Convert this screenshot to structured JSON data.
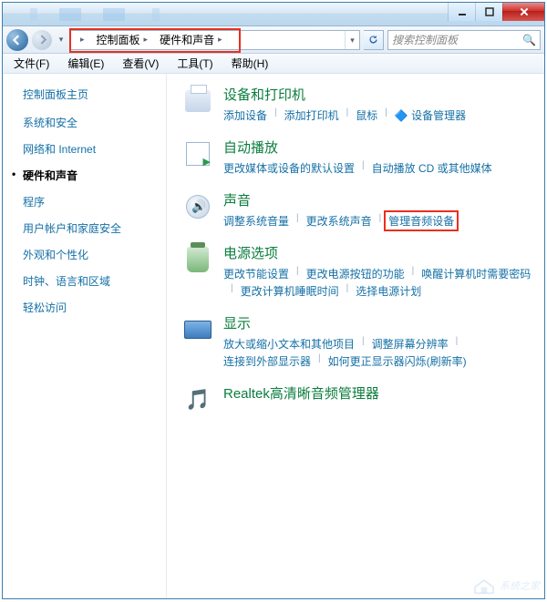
{
  "breadcrumb": {
    "root": "控制面板",
    "current": "硬件和声音"
  },
  "search": {
    "placeholder": "搜索控制面板"
  },
  "menu": {
    "file": "文件(F)",
    "edit": "编辑(E)",
    "view": "查看(V)",
    "tools": "工具(T)",
    "help": "帮助(H)"
  },
  "sidebar": {
    "title": "控制面板主页",
    "items": [
      "系统和安全",
      "网络和 Internet",
      "硬件和声音",
      "程序",
      "用户帐户和家庭安全",
      "外观和个性化",
      "时钟、语言和区域",
      "轻松访问"
    ],
    "active_index": 2
  },
  "categories": [
    {
      "icon": "printer",
      "title": "设备和打印机",
      "links": [
        "添加设备",
        "添加打印机",
        "鼠标",
        "🔷 设备管理器"
      ]
    },
    {
      "icon": "autoplay",
      "title": "自动播放",
      "links": [
        "更改媒体或设备的默认设置",
        "自动播放 CD 或其他媒体"
      ]
    },
    {
      "icon": "sound",
      "title": "声音",
      "links": [
        "调整系统音量",
        "更改系统声音",
        "管理音频设备"
      ],
      "highlight_index": 2
    },
    {
      "icon": "power",
      "title": "电源选项",
      "links": [
        "更改节能设置",
        "更改电源按钮的功能",
        "唤醒计算机时需要密码",
        "更改计算机睡眠时间",
        "选择电源计划"
      ]
    },
    {
      "icon": "display",
      "title": "显示",
      "links": [
        "放大或缩小文本和其他项目",
        "调整屏幕分辨率",
        "连接到外部显示器",
        "如何更正显示器闪烁(刷新率)"
      ]
    },
    {
      "icon": "realtek",
      "title": "Realtek高清晰音频管理器",
      "links": []
    }
  ],
  "watermark": "系统之家"
}
